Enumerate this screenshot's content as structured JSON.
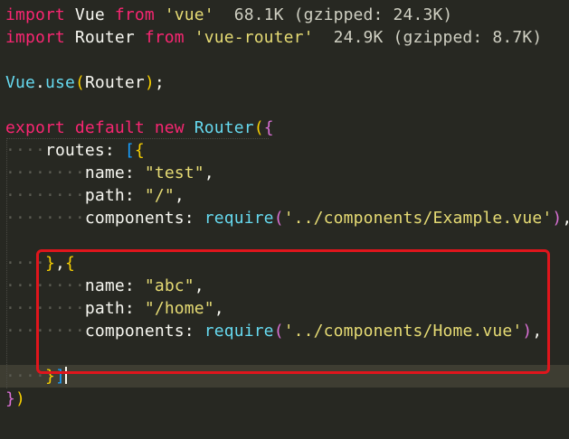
{
  "editor": {
    "theme_colors": {
      "background": "#272822",
      "keyword": "#f92672",
      "string": "#e6db74",
      "function": "#66d9ef",
      "text": "#f8f8f2",
      "highlight_border": "#e0151c"
    },
    "line1": {
      "kw_import": "import",
      "name": " Vue ",
      "kw_from": "from",
      "module": " 'vue'",
      "size": "  68.1K (gzipped: 24.3K)"
    },
    "line2": {
      "kw_import": "import",
      "name": " Router ",
      "kw_from": "from",
      "module": " 'vue-router'",
      "size": "  24.9K (gzipped: 8.7K)"
    },
    "line4": {
      "obj": "Vue",
      "dot": ".",
      "method": "use",
      "open": "(",
      "arg": "Router",
      "close": ")",
      "semi": ";"
    },
    "line6": {
      "kw_export": "export",
      "kw_default": " default",
      "kw_new": " new",
      "class": " Router",
      "open": "(",
      "brace": "{"
    },
    "line7": {
      "indent": "····",
      "key": "routes",
      "colon": ": ",
      "open_bracket": "[",
      "open_brace": "{"
    },
    "line8": {
      "indent": "········",
      "key": "name",
      "colon": ": ",
      "value": "\"test\"",
      "comma": ","
    },
    "line9": {
      "indent": "········",
      "key": "path",
      "colon": ": ",
      "value": "\"/\"",
      "comma": ","
    },
    "line10": {
      "indent": "········",
      "key": "components",
      "colon": ": ",
      "fn": "require",
      "open": "(",
      "value": "'../components/Example.vue'",
      "close": ")",
      "comma": ","
    },
    "line12": {
      "indent": "····",
      "close_brace": "}",
      "comma": ",",
      "open_brace": "{"
    },
    "line13": {
      "indent": "········",
      "key": "name",
      "colon": ": ",
      "value": "\"abc\"",
      "comma": ","
    },
    "line14": {
      "indent": "········",
      "key": "path",
      "colon": ": ",
      "value": "\"/home\"",
      "comma": ","
    },
    "line15": {
      "indent": "········",
      "key": "components",
      "colon": ": ",
      "fn": "require",
      "open": "(",
      "value": "'../components/Home.vue'",
      "close": ")",
      "comma": ","
    },
    "line17": {
      "indent": "····",
      "close_brace": "}",
      "close_bracket": "]"
    },
    "line18": {
      "close_brace": "}",
      "close_paren": ")"
    }
  }
}
